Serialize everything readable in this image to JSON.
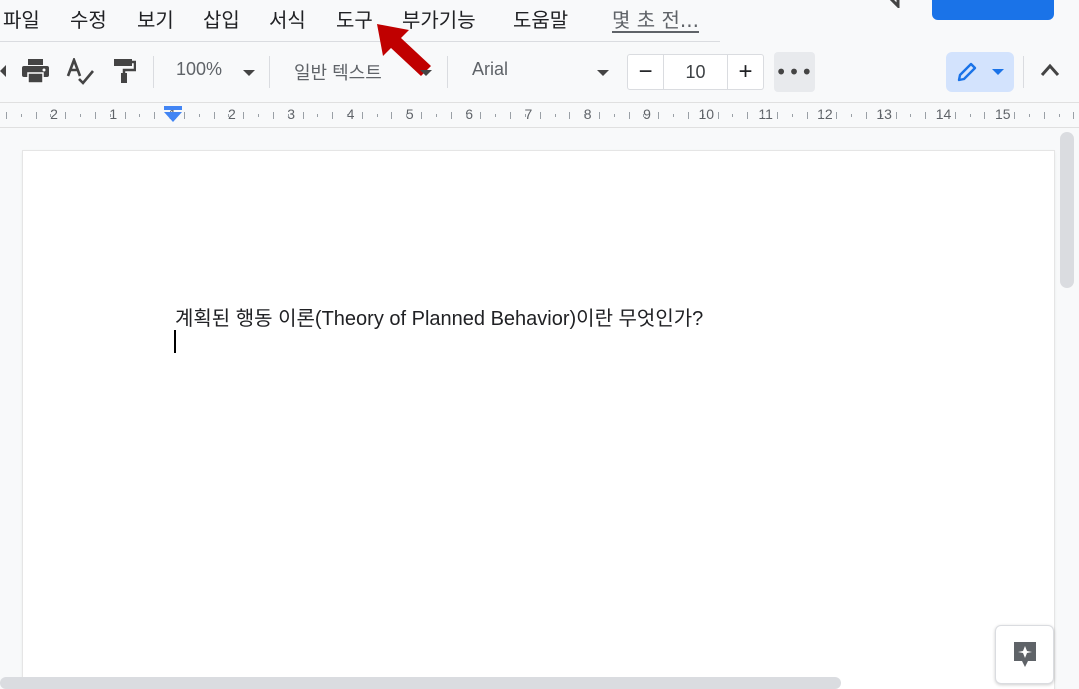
{
  "menubar": {
    "items": [
      "파일",
      "수정",
      "보기",
      "삽입",
      "서식",
      "도구",
      "부가기능",
      "도움말"
    ],
    "last_edit": "몇 초 전..."
  },
  "toolbar": {
    "zoom": "100%",
    "style": "일반 텍스트",
    "font": "Arial",
    "font_size": "10",
    "minus": "−",
    "plus": "+",
    "more": "•••"
  },
  "ruler": {
    "labels": [
      "2",
      "1",
      "1",
      "2",
      "3",
      "4",
      "5",
      "6",
      "7",
      "8",
      "9",
      "10",
      "11",
      "12",
      "13",
      "14",
      "15"
    ]
  },
  "document": {
    "line1": "계획된 행동 이론(Theory of Planned Behavior)이란 무엇인가?"
  },
  "colors": {
    "accent": "#1a73e8",
    "arrow": "#c00000"
  },
  "icons": [
    "print-icon",
    "spellcheck-icon",
    "paint-format-icon",
    "pencil-icon",
    "chevron-up-icon",
    "explore-icon",
    "comment-icon"
  ]
}
